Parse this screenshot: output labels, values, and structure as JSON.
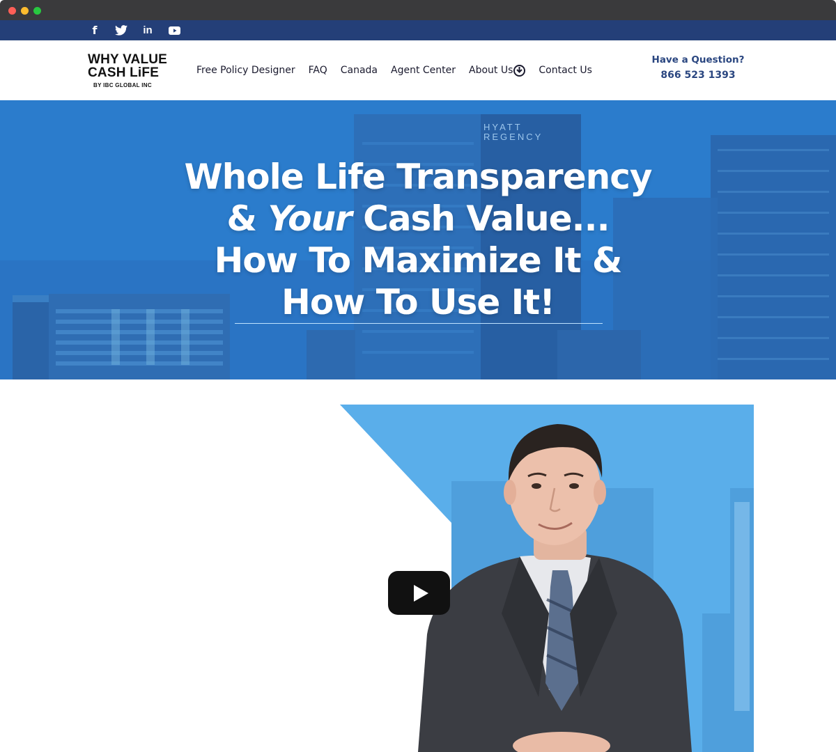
{
  "browser": {
    "window_controls": [
      "close",
      "minimize",
      "maximize"
    ]
  },
  "social": {
    "icons": [
      "facebook-icon",
      "twitter-icon",
      "linkedin-icon",
      "youtube-icon"
    ],
    "facebook_glyph": "f",
    "linkedin_glyph": "in"
  },
  "logo": {
    "line1": "WHY VALUE",
    "line2": "CASH LiFE",
    "line3": "BY IBC GLOBAL INC"
  },
  "nav": {
    "items": [
      {
        "label": "Free Policy Designer"
      },
      {
        "label": "FAQ"
      },
      {
        "label": "Canada"
      },
      {
        "label": "Agent Center"
      },
      {
        "label": "About Us"
      },
      {
        "label": "Contact Us"
      }
    ]
  },
  "contact": {
    "question": "Have a Question?",
    "phone": "866 523 1393"
  },
  "hero": {
    "line1": "Whole Life Transparency",
    "line2_prefix": "& ",
    "line2_em": "Your",
    "line2_suffix": " Cash Value...",
    "line3": "How To Maximize It &",
    "line4": "How To Use It!",
    "building_sign_1": "HYATT",
    "building_sign_2": "REGENCY"
  },
  "colors": {
    "social_bar": "#243f78",
    "hero_blue": "#2c7fd0",
    "nav_text": "#1a1a2e",
    "contact_text": "#2a4680",
    "video_panel": "#5aaeea"
  }
}
